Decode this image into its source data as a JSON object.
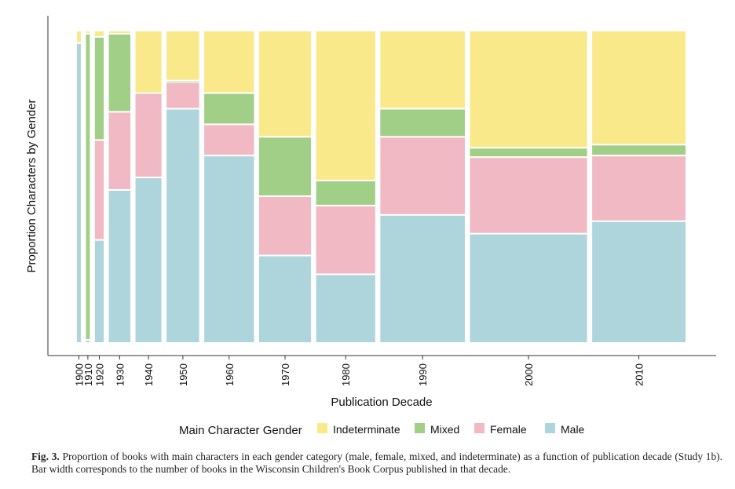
{
  "chart_data": {
    "type": "mosaic",
    "xlabel": "Publication Decade",
    "ylabel": "Proportion Characters by Gender",
    "ylim": [
      0,
      1
    ],
    "grid": false,
    "legend": {
      "title": "Main Character Gender",
      "placement": "bottom",
      "entries": [
        "Indeterminate",
        "Mixed",
        "Female",
        "Male"
      ]
    },
    "colors": {
      "Indeterminate": "#FAE98A",
      "Mixed": "#A2CF88",
      "Female": "#F1B9C3",
      "Male": "#ADD5DB"
    },
    "categories": [
      "1900",
      "1910",
      "1920",
      "1930",
      "1940",
      "1950",
      "1960",
      "1970",
      "1980",
      "1990",
      "2000",
      "2010"
    ],
    "book_share": [
      0.007,
      0.007,
      0.016,
      0.039,
      0.047,
      0.059,
      0.09,
      0.094,
      0.107,
      0.153,
      0.212,
      0.169
    ],
    "series": [
      {
        "name": "Male",
        "values": [
          0.96,
          0.01,
          0.33,
          0.49,
          0.53,
          0.75,
          0.6,
          0.28,
          0.22,
          0.41,
          0.35,
          0.39
        ]
      },
      {
        "name": "Female",
        "values": [
          0,
          0,
          0.32,
          0.25,
          0.27,
          0.085,
          0.1,
          0.19,
          0.22,
          0.25,
          0.245,
          0.21
        ]
      },
      {
        "name": "Mixed",
        "values": [
          0,
          0.98,
          0.33,
          0.25,
          0,
          0.005,
          0.1,
          0.19,
          0.08,
          0.09,
          0.03,
          0.035
        ]
      },
      {
        "name": "Indeterminate",
        "values": [
          0.04,
          0.01,
          0.02,
          0.01,
          0.2,
          0.16,
          0.2,
          0.34,
          0.48,
          0.25,
          0.375,
          0.365
        ]
      }
    ]
  },
  "caption": {
    "label": "Fig. 3.",
    "text": "Proportion of books with main characters in each gender category (male, female, mixed, and indeterminate) as a function of publication decade (Study 1b). Bar width corresponds to the number of books in the Wisconsin Children's Book Corpus published in that decade."
  }
}
